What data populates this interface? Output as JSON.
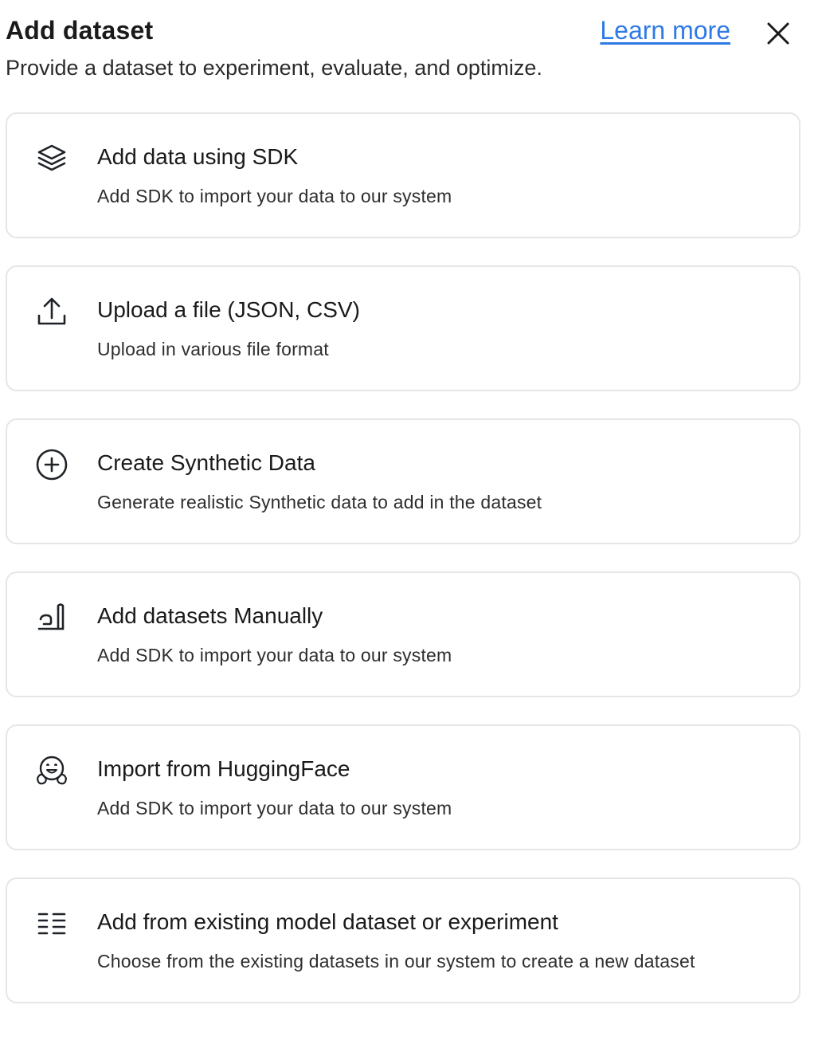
{
  "header": {
    "title": "Add dataset",
    "learn_more": "Learn more",
    "subtitle": "Provide a dataset to experiment, evaluate, and optimize.",
    "close_icon": "close-icon"
  },
  "colors": {
    "link": "#2f7ae5",
    "card_border": "#e6e6e6"
  },
  "options": [
    {
      "icon": "layers-icon",
      "title": "Add data using SDK",
      "description": "Add SDK to import your data to our system"
    },
    {
      "icon": "upload-icon",
      "title": "Upload a file (JSON, CSV)",
      "description": "Upload in various file format"
    },
    {
      "icon": "plus-circle-icon",
      "title": "Create Synthetic Data",
      "description": "Generate realistic Synthetic data to add in the dataset"
    },
    {
      "icon": "hand-pen-icon",
      "title": "Add datasets Manually",
      "description": "Add SDK to import your data to our system"
    },
    {
      "icon": "huggingface-icon",
      "title": "Import from HuggingFace",
      "description": "Add SDK to import your data to our system"
    },
    {
      "icon": "list-icon",
      "title": "Add from existing model dataset or experiment",
      "description": "Choose from the existing datasets in our system to create a new dataset"
    }
  ]
}
